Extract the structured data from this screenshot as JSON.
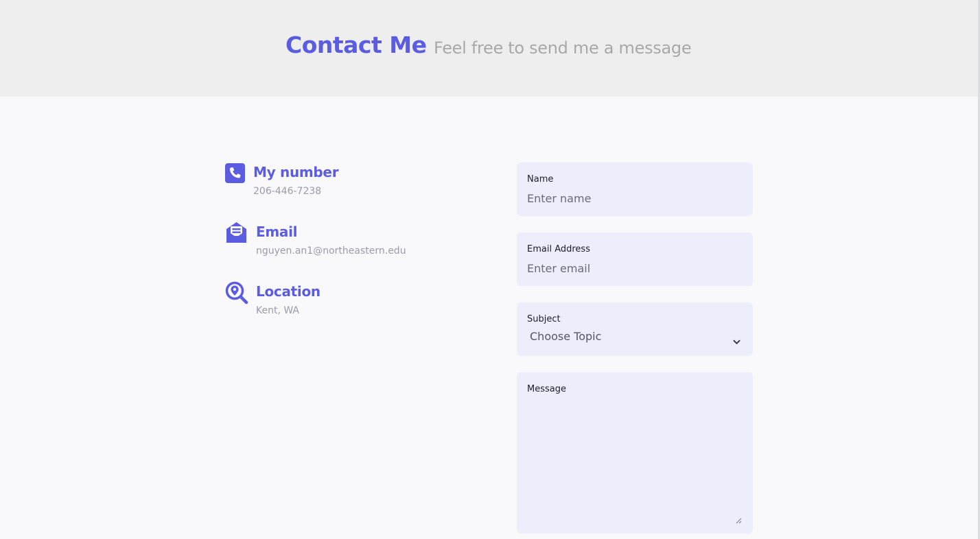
{
  "header": {
    "title": "Contact Me",
    "subtitle": "Feel free to send me a message"
  },
  "contact_info": {
    "phone": {
      "icon": "phone-icon",
      "title": "My number",
      "value": "206-446-7238"
    },
    "email": {
      "icon": "envelope-open-icon",
      "title": "Email",
      "value": "nguyen.an1@northeastern.edu"
    },
    "location": {
      "icon": "search-location-icon",
      "title": "Location",
      "value": "Kent, WA"
    }
  },
  "form": {
    "name": {
      "label": "Name",
      "placeholder": "Enter name"
    },
    "email": {
      "label": "Email Address",
      "placeholder": "Enter email"
    },
    "subject": {
      "label": "Subject",
      "selected": "Choose Topic"
    },
    "message": {
      "label": "Message",
      "placeholder": ""
    }
  },
  "colors": {
    "accent": "#5b5ce0",
    "header_bg": "#eeeeee",
    "page_bg": "#f9f9fc",
    "field_bg": "#eceefb",
    "muted_text": "#a8a8a8"
  }
}
